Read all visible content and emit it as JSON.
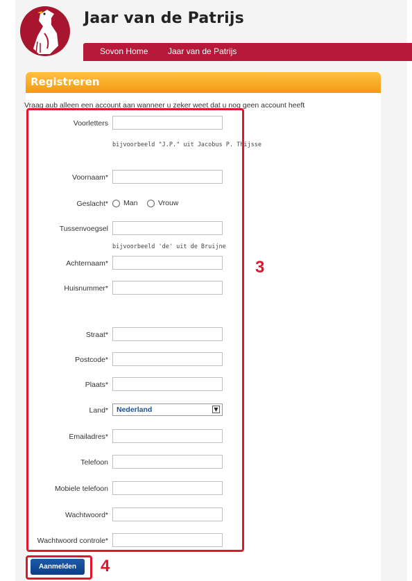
{
  "site": {
    "title": "Jaar van de Patrijs"
  },
  "nav": {
    "items": [
      "Sovon Home",
      "Jaar van de Patrijs"
    ]
  },
  "panel": {
    "title": "Registreren"
  },
  "intro": {
    "before": "Vraag aub alleen een account aan wanneer u ",
    "emphasis": "zeker",
    "after": " weet dat u nog geen account heeft"
  },
  "form": {
    "voorletters": {
      "label": "Voorletters",
      "value": "",
      "hint": "bijvoorbeeld \"J.P.\" uit Jacobus P. Thijsse"
    },
    "voornaam": {
      "label": "Voornaam*",
      "value": ""
    },
    "geslacht": {
      "label": "Geslacht*",
      "options": [
        "Man",
        "Vrouw"
      ]
    },
    "tussenvoegsel": {
      "label": "Tussenvoegsel",
      "value": "",
      "hint": "bijvoorbeeld 'de' uit de Bruijne"
    },
    "achternaam": {
      "label": "Achternaam*",
      "value": ""
    },
    "huisnummer": {
      "label": "Huisnummer*",
      "value": ""
    },
    "straat": {
      "label": "Straat*",
      "value": ""
    },
    "postcode": {
      "label": "Postcode*",
      "value": ""
    },
    "plaats": {
      "label": "Plaats*",
      "value": ""
    },
    "land": {
      "label": "Land*",
      "selected": "Nederland"
    },
    "emailadres": {
      "label": "Emailadres*",
      "value": ""
    },
    "telefoon": {
      "label": "Telefoon",
      "value": ""
    },
    "mobiele_telefoon": {
      "label": "Mobiele telefoon",
      "value": ""
    },
    "wachtwoord": {
      "label": "Wachtwoord*",
      "value": ""
    },
    "wachtwoord_controle": {
      "label": "Wachtwoord controle*",
      "value": ""
    },
    "submit_label": "Aanmelden"
  },
  "annotations": {
    "box3": "3",
    "box4": "4",
    "color": "#e1152b"
  },
  "colors": {
    "nav": "#b7193a",
    "panel_header": "#f5a623",
    "button": "#0c3f86"
  },
  "icons": {
    "logo": "partridge-logo",
    "select_arrow": "chevron-down-icon"
  }
}
